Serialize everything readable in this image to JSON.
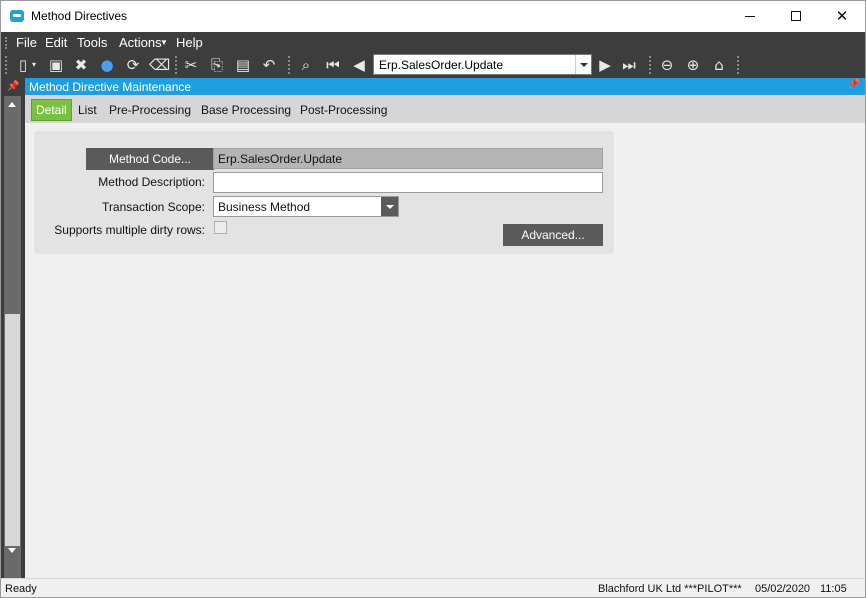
{
  "window": {
    "title": "Method Directives"
  },
  "menu": {
    "file": "File",
    "edit": "Edit",
    "tools": "Tools",
    "actions": "Actions",
    "help": "Help"
  },
  "toolbar": {
    "record_combo_value": "Erp.SalesOrder.Update"
  },
  "panel": {
    "title": "Method Directive Maintenance"
  },
  "tabs": [
    {
      "label": "Detail",
      "active": true
    },
    {
      "label": "List",
      "active": false
    },
    {
      "label": "Pre-Processing",
      "active": false
    },
    {
      "label": "Base Processing",
      "active": false
    },
    {
      "label": "Post-Processing",
      "active": false
    }
  ],
  "form": {
    "method_code_button": "Method Code...",
    "method_code_value": "Erp.SalesOrder.Update",
    "method_description_label": "Method Description:",
    "method_description_value": "",
    "transaction_scope_label": "Transaction Scope:",
    "transaction_scope_value": "Business Method",
    "supports_dirty_rows_label": "Supports multiple dirty rows:",
    "supports_dirty_rows_checked": false,
    "advanced_button": "Advanced..."
  },
  "status": {
    "state": "Ready",
    "company": "Blachford UK Ltd ***PILOT***",
    "date": "05/02/2020",
    "time": "11:05"
  },
  "colors": {
    "accent_blue": "#1ea0e0",
    "active_tab_green": "#7ac143",
    "toolbar_dark": "#3d3d3d"
  }
}
